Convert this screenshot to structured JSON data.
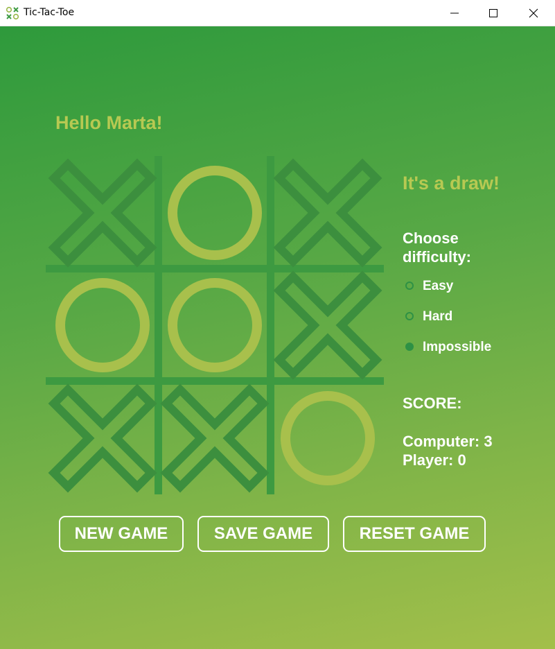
{
  "window": {
    "title": "Tic-Tac-Toe",
    "controls": [
      "minimize",
      "maximize",
      "close"
    ]
  },
  "greeting": "Hello Marta!",
  "status": "It's a draw!",
  "board": {
    "cells": [
      "X",
      "O",
      "X",
      "O",
      "O",
      "X",
      "X",
      "X",
      "O"
    ],
    "colors": {
      "x": "#3c8f3e",
      "o": "#a8c04c",
      "grid": "#3d9a41"
    }
  },
  "difficulty": {
    "title": "Choose difficulty:",
    "options": [
      {
        "label": "Easy",
        "selected": false
      },
      {
        "label": "Hard",
        "selected": false
      },
      {
        "label": "Impossible",
        "selected": true
      }
    ]
  },
  "score": {
    "title": "SCORE:",
    "computer": "Computer: 3",
    "player": "Player: 0"
  },
  "buttons": {
    "new_game": "NEW GAME",
    "save_game": "SAVE GAME",
    "reset_game": "RESET GAME"
  }
}
